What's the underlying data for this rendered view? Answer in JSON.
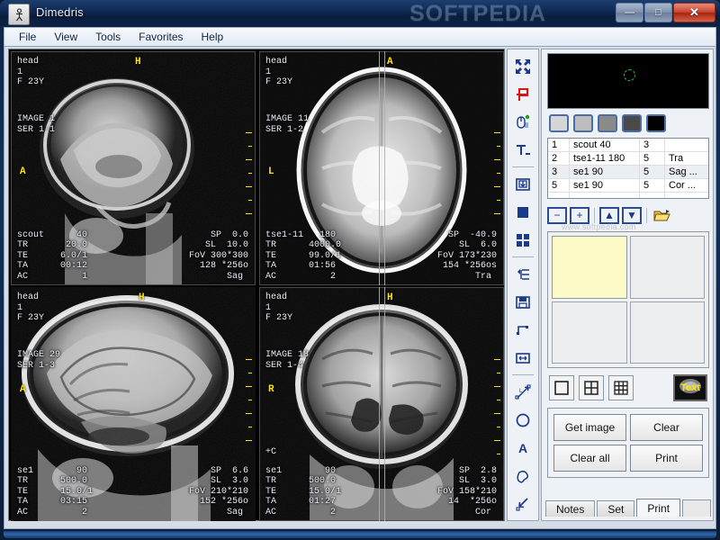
{
  "window": {
    "title": "Dimedris",
    "app_icon": "person-icon",
    "watermark": "SOFTPEDIA",
    "sub_watermark": "www.softpedia.com",
    "controls": [
      {
        "name": "minimize-button",
        "glyph": "—"
      },
      {
        "name": "maximize-button",
        "glyph": "□"
      },
      {
        "name": "close-button",
        "glyph": "✕"
      }
    ]
  },
  "menu": {
    "items": [
      {
        "label": "File"
      },
      {
        "label": "View"
      },
      {
        "label": "Tools"
      },
      {
        "label": "Favorites"
      },
      {
        "label": "Help"
      }
    ]
  },
  "viewports": [
    {
      "id": "viewport-1",
      "selected": false,
      "patient": "head",
      "study": "1",
      "demographics": "F 23Y",
      "image_label": "IMAGE 1",
      "series_label": "SER 1-1",
      "marker_top": "H",
      "marker_left": "A",
      "contrast": "",
      "crosshair": false,
      "params_left": [
        {
          "key": "scout",
          "value": "40"
        },
        {
          "key": "TR",
          "value": "20.0"
        },
        {
          "key": "TE",
          "value": "6.0/1"
        },
        {
          "key": "TA",
          "value": "00:12"
        },
        {
          "key": "AC",
          "value": "1"
        }
      ],
      "params_right": [
        {
          "key": "SP",
          "value": "0.0"
        },
        {
          "key": "SL",
          "value": "10.0"
        },
        {
          "key": "FoV",
          "value": "300*300"
        },
        {
          "key": "",
          "value": "128 *256o"
        },
        {
          "key": "Sag",
          "value": ""
        }
      ]
    },
    {
      "id": "viewport-2",
      "selected": false,
      "patient": "head",
      "study": "1",
      "demographics": "F 23Y",
      "image_label": "IMAGE 11",
      "series_label": "SER 1-2",
      "marker_top": "A",
      "marker_left": "L",
      "contrast": "",
      "crosshair": true,
      "params_left": [
        {
          "key": "tse1-11",
          "value": "180"
        },
        {
          "key": "TR",
          "value": "4000.0"
        },
        {
          "key": "TE",
          "value": "99.0/1"
        },
        {
          "key": "TA",
          "value": "01:56"
        },
        {
          "key": "AC",
          "value": "2"
        }
      ],
      "params_right": [
        {
          "key": "SP",
          "value": "-40.9"
        },
        {
          "key": "SL",
          "value": "6.0"
        },
        {
          "key": "FoV",
          "value": "173*230"
        },
        {
          "key": "",
          "value": "154 *256os"
        },
        {
          "key": "Tra",
          "value": ""
        }
      ]
    },
    {
      "id": "viewport-3",
      "selected": true,
      "patient": "head",
      "study": "1",
      "demographics": "F 23Y",
      "image_label": "IMAGE 29",
      "series_label": "SER 1-3",
      "marker_top": "H",
      "marker_left": "A",
      "contrast": "",
      "crosshair": false,
      "params_left": [
        {
          "key": "se1",
          "value": "90"
        },
        {
          "key": "TR",
          "value": "500.0"
        },
        {
          "key": "TE",
          "value": "15.0/1"
        },
        {
          "key": "TA",
          "value": "03:15"
        },
        {
          "key": "AC",
          "value": "2"
        }
      ],
      "params_right": [
        {
          "key": "SP",
          "value": "6.6"
        },
        {
          "key": "SL",
          "value": "3.0"
        },
        {
          "key": "FoV",
          "value": "210*210"
        },
        {
          "key": "",
          "value": "152 *256o"
        },
        {
          "key": "Sag",
          "value": ""
        }
      ]
    },
    {
      "id": "viewport-4",
      "selected": false,
      "patient": "head",
      "study": "1",
      "demographics": "F 23Y",
      "image_label": "IMAGE 18",
      "series_label": "SER 1-4",
      "marker_top": "H",
      "marker_left": "R",
      "contrast": "+C",
      "crosshair": true,
      "params_left": [
        {
          "key": "se1",
          "value": "90"
        },
        {
          "key": "TR",
          "value": "500.0"
        },
        {
          "key": "TE",
          "value": "15.0/1"
        },
        {
          "key": "TA",
          "value": "01:27"
        },
        {
          "key": "AC",
          "value": "2"
        }
      ],
      "params_right": [
        {
          "key": "SP",
          "value": "2.8"
        },
        {
          "key": "SL",
          "value": "3.0"
        },
        {
          "key": "FoV",
          "value": "158*210"
        },
        {
          "key": "",
          "value": "14  *256o"
        },
        {
          "key": "Cor",
          "value": ""
        }
      ]
    }
  ],
  "toolbar": {
    "tools": [
      {
        "name": "fit-to-window-icon",
        "title": "Fit"
      },
      {
        "name": "flag-marker-icon",
        "title": "Marker"
      },
      {
        "name": "mouse-tool-icon",
        "title": "Mouse"
      },
      {
        "name": "text-underline-icon",
        "title": "Text"
      },
      {
        "name": "import-image-icon",
        "title": "Import"
      },
      {
        "name": "fill-square-icon",
        "title": "Fill"
      },
      {
        "name": "grid-view-icon",
        "title": "Grid"
      },
      {
        "name": "indent-icon",
        "title": "Indent"
      },
      {
        "name": "save-icon",
        "title": "Save"
      },
      {
        "name": "angle-measure-icon",
        "title": "Angle"
      },
      {
        "name": "width-measure-icon",
        "title": "Width"
      },
      {
        "name": "distance-measure-icon",
        "title": "Distance"
      },
      {
        "name": "ellipse-roi-icon",
        "title": "Ellipse"
      },
      {
        "name": "annotate-text-icon",
        "title": "Annotate"
      },
      {
        "name": "freehand-roi-icon",
        "title": "Freehand"
      },
      {
        "name": "arrow-pointer-icon",
        "title": "Arrow"
      }
    ]
  },
  "right_panel": {
    "grid_map": {
      "name": "position-map",
      "cols": 10,
      "rows": 5,
      "marker": "series-position-marker"
    },
    "window_swatches": [
      {
        "name": "swatch-1",
        "color": "#d6d6d6"
      },
      {
        "name": "swatch-2",
        "color": "#bdbdbd"
      },
      {
        "name": "swatch-3",
        "color": "#8a8a8a"
      },
      {
        "name": "swatch-4",
        "color": "#4a4a4a"
      },
      {
        "name": "swatch-5",
        "color": "#000000"
      }
    ],
    "series_table": {
      "rows": [
        {
          "num": "1",
          "name": "scout    40",
          "count": "3",
          "plane": "",
          "more": "",
          "selected": false
        },
        {
          "num": "2",
          "name": "tse1-11 180",
          "count": "5",
          "plane": "Tra",
          "more": "",
          "selected": false
        },
        {
          "num": "3",
          "name": "se1      90",
          "count": "5",
          "plane": "Sag",
          "more": "...",
          "selected": true
        },
        {
          "num": "5",
          "name": "se1      90",
          "count": "5",
          "plane": "Cor",
          "more": "...",
          "selected": false
        }
      ]
    },
    "nav_buttons": [
      {
        "name": "zoom-out-button",
        "glyph": "−"
      },
      {
        "name": "zoom-in-button",
        "glyph": "+"
      },
      {
        "name": "previous-image-button",
        "glyph": "▲"
      },
      {
        "name": "next-image-button",
        "glyph": "▼"
      },
      {
        "name": "open-folder-button",
        "glyph": "folder-open-icon"
      }
    ],
    "layout_buttons": [
      {
        "name": "layout-1x1-button"
      },
      {
        "name": "layout-2x2-button"
      },
      {
        "name": "layout-3x3-button"
      }
    ],
    "text_overlay_button": {
      "name": "text-overlay-button",
      "label": "Text"
    },
    "actions": [
      {
        "name": "get-image-button",
        "label": "Get image"
      },
      {
        "name": "clear-button",
        "label": "Clear"
      },
      {
        "name": "clear-all-button",
        "label": "Clear all"
      },
      {
        "name": "print-button",
        "label": "Print"
      }
    ],
    "tabs": [
      {
        "name": "tab-notes",
        "label": "Notes",
        "active": false
      },
      {
        "name": "tab-set",
        "label": "Set",
        "active": false
      },
      {
        "name": "tab-print",
        "label": "Print",
        "active": true
      }
    ]
  },
  "colors": {
    "selection_green": "#13e913",
    "marker_yellow": "#ffe400",
    "crosshair_green": "#3dfd3d",
    "accent_blue": "#1b3a8a"
  }
}
